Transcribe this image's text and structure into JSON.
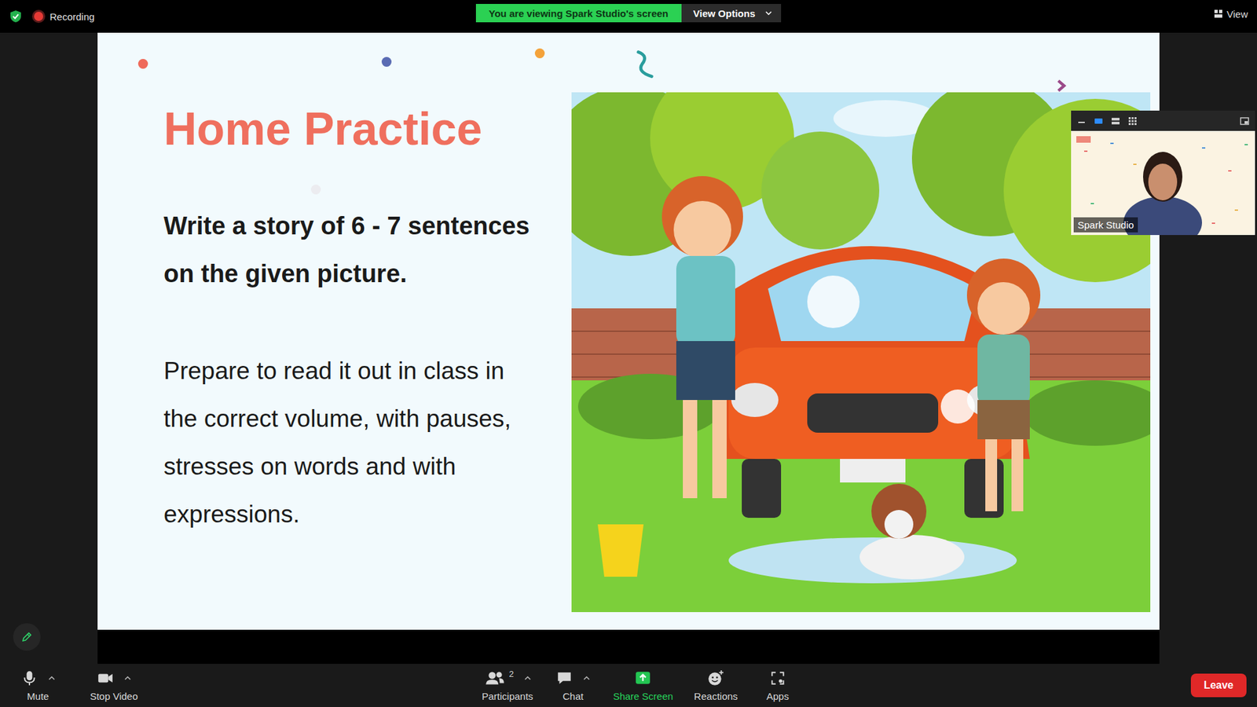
{
  "top_bar": {
    "recording": "Recording",
    "banner": "You are viewing Spark Studio's screen",
    "view_options": "View Options",
    "view": "View"
  },
  "slide": {
    "title": "Home Practice",
    "task": "Write a story of 6 - 7 sentences on the given picture.",
    "instructions": "Prepare to read it out in class in the correct volume, with pauses, stresses on words and with expressions."
  },
  "video": {
    "name": "Spark Studio"
  },
  "toolbar": {
    "left": [
      {
        "label": "Mute",
        "kind": "mic",
        "caret": true,
        "color": "#d8d8d8"
      },
      {
        "label": "Stop Video",
        "kind": "camera",
        "caret": true,
        "color": "#d8d8d8"
      }
    ],
    "center": [
      {
        "label": "Participants",
        "kind": "participants",
        "count": "2",
        "caret": true,
        "color": "#d8d8d8"
      },
      {
        "label": "Chat",
        "kind": "chat",
        "count": "",
        "caret": true,
        "color": "#d8d8d8"
      },
      {
        "label": "Share Screen",
        "kind": "share",
        "count": "",
        "caret": false,
        "color": "#27d45a"
      },
      {
        "label": "Reactions",
        "kind": "reactions",
        "count": "",
        "caret": false,
        "color": "#d8d8d8"
      },
      {
        "label": "Apps",
        "kind": "apps",
        "count": "",
        "caret": false,
        "color": "#d8d8d8"
      }
    ],
    "leave": "Leave"
  }
}
